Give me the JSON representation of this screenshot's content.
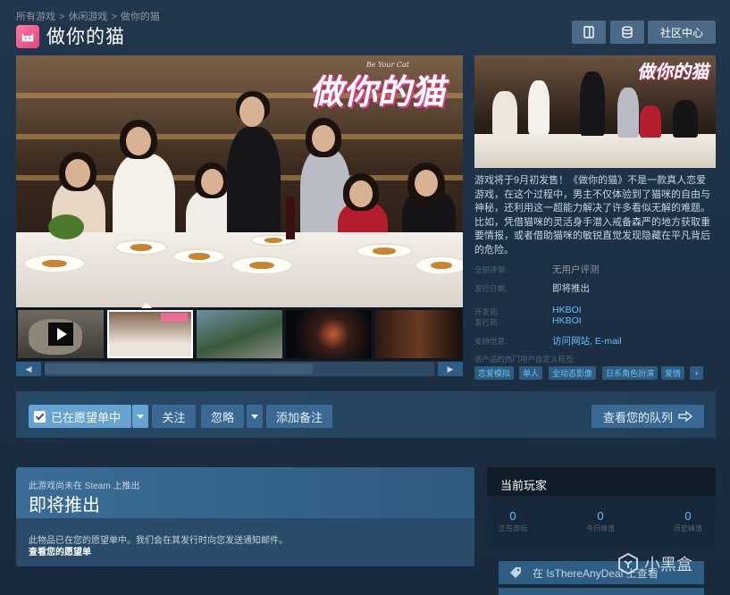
{
  "breadcrumb": {
    "items": [
      "所有游戏",
      "休闲游戏",
      "做你的猫"
    ],
    "separator": ">"
  },
  "header": {
    "title": "做你的猫",
    "community_label": "社区中心",
    "icons": [
      "review-icon",
      "database-icon"
    ]
  },
  "media": {
    "logo_text": "做你的猫",
    "logo_subtitle": "Be Your Cat"
  },
  "description": "游戏将于9月初发售！《做你的猫》不是一款真人恋爱游戏，在这个过程中，男主不仅体验到了猫咪的自由与神秘，还利用这一超能力解决了许多看似无解的难题。比如，凭借猫咪的灵活身手潜入戒备森严的地方获取重要情报，或者借助猫咪的敏锐直觉发现隐藏在平凡背后的危险。",
  "info": {
    "all_reviews_label": "全部评测:",
    "all_reviews_value": "无用户评测",
    "release_label": "发行日期:",
    "release_value": "即将推出",
    "developer_label": "开发商:",
    "developer_value": "HKBOI",
    "publisher_label": "发行商:",
    "publisher_value": "HKBOI",
    "support_label": "支持信息:",
    "website": "访问网站",
    "email": "E-mail",
    "tags_label": "该产品的热门用户自定义标签:",
    "tags": [
      "恋爱模拟",
      "单人",
      "全动态影像",
      "日系角色扮演",
      "爱情",
      "+"
    ]
  },
  "actions": {
    "wishlist": "已在愿望单中",
    "follow": "关注",
    "ignore": "忽略",
    "add_note": "添加备注",
    "queue": "查看您的队列"
  },
  "notice": {
    "small": "此游戏尚未在 Steam 上推出",
    "big": "即将推出",
    "message": "此物品已在您的愿望单中。我们会在其发行时向您发送通知邮件。",
    "link": "查看您的愿望单"
  },
  "players": {
    "title": "当前玩家",
    "stats": [
      {
        "value": "0",
        "label": "正在游玩"
      },
      {
        "value": "0",
        "label": "今日峰值"
      },
      {
        "value": "0",
        "label": "历史峰值"
      }
    ]
  },
  "itad": {
    "label": "在 IsThereAnyDeal 上查看"
  },
  "watermark": {
    "text": "小黑盒"
  },
  "colors": {
    "accent": "#66c0f4",
    "background": "#1b2838",
    "wishlist": "#64a3d2"
  }
}
